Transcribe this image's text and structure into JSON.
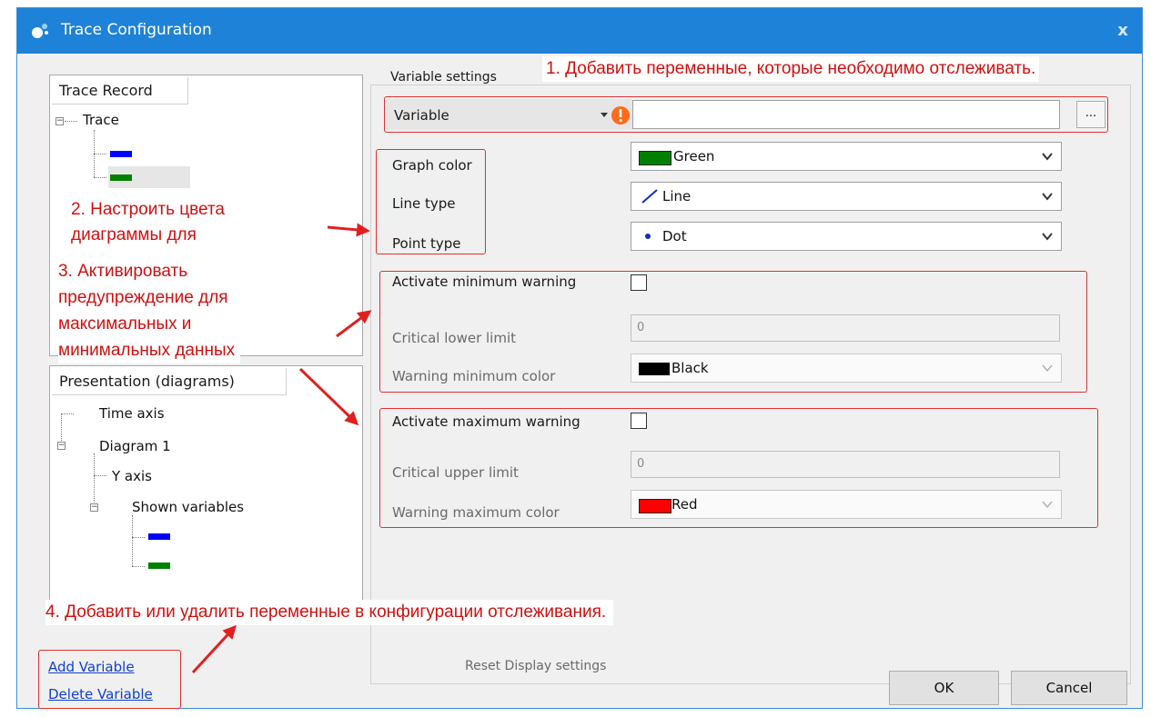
{
  "window": {
    "title": "Trace Configuration",
    "close_label": "x"
  },
  "left": {
    "trace_record_header": "Trace Record",
    "trace_root": "Trace",
    "presentation_header": "Presentation (diagrams)",
    "time_axis": "Time axis",
    "diagram": "Diagram 1",
    "y_axis": "Y axis",
    "shown_variables": "Shown variables"
  },
  "variable_settings": {
    "group_label": "Variable settings",
    "variable_label": "Variable",
    "variable_value": "",
    "browse_label": "...",
    "graph_color_label": "Graph color",
    "graph_color_value": "Green",
    "line_type_label": "Line type",
    "line_type_value": "Line",
    "point_type_label": "Point type",
    "point_type_value": "Dot",
    "act_min_label": "Activate minimum warning",
    "lower_limit_label": "Critical lower limit",
    "lower_limit_value": "0",
    "warn_min_color_label": "Warning minimum color",
    "warn_min_color_value": "Black",
    "act_max_label": "Activate maximum warning",
    "upper_limit_label": "Critical upper limit",
    "upper_limit_value": "0",
    "warn_max_color_label": "Warning maximum color",
    "warn_max_color_value": "Red"
  },
  "footer": {
    "add_variable": "Add Variable",
    "delete_variable": "Delete Variable",
    "reset_display": "Reset Display settings",
    "ok": "OK",
    "cancel": "Cancel"
  },
  "annotations": {
    "a1": "1. Добавить переменные, которые необходимо отслеживать.",
    "a2_line1": "2. Настроить цвета",
    "a2_line2": "диаграммы для",
    "a3_line1": "3. Активировать",
    "a3_line2": "предупреждение для",
    "a3_line3": "максимальных и",
    "a3_line4": "минимальных данных",
    "a4": "4. Добавить или удалить переменные в конфигурации отслеживания."
  },
  "colors": {
    "titlebar": "#1e82d8",
    "blue_swatch": "#0000ff",
    "green_swatch": "#008000",
    "annotation_red": "#e03030",
    "black_swatch": "#000000",
    "red_swatch": "#ff0000"
  }
}
